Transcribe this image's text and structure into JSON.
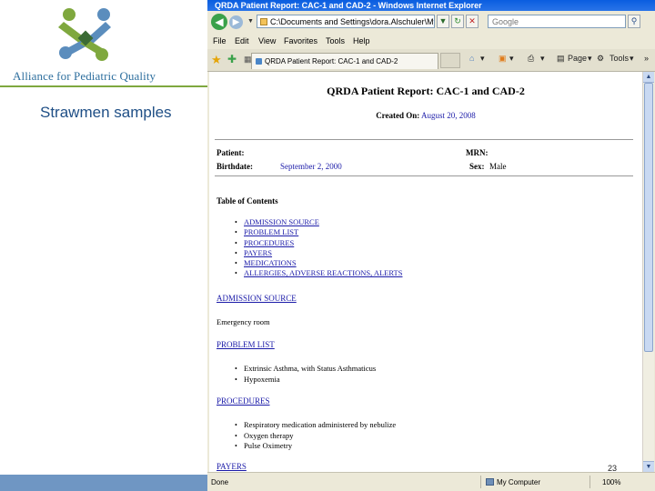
{
  "slide": {
    "org_name": "Alliance for Pediatric Quality",
    "subtitle": "Strawmen samples",
    "page_number": "23"
  },
  "browser": {
    "title": "QRDA Patient Report: CAC-1 and CAD-2 - Windows Internet Explorer",
    "address": "C:\\Documents and Settings\\dora.Alschuler\\My D",
    "search_placeholder": "Google",
    "menu": [
      "File",
      "Edit",
      "View",
      "Favorites",
      "Tools",
      "Help"
    ],
    "tab_title": "QRDA Patient Report: CAC-1 and CAD-2",
    "toolbar": {
      "page_label": "Page",
      "tools_label": "Tools"
    },
    "status": {
      "done": "Done",
      "zone": "My Computer",
      "zoom": "100%"
    }
  },
  "report": {
    "title": "QRDA Patient Report: CAC-1 and CAD-2",
    "created_label": "Created On:",
    "created_value": "August 20, 2008",
    "patient_label": "Patient:",
    "mrn_label": "MRN:",
    "birthdate_label": "Birthdate:",
    "birthdate_value": "September 2, 2000",
    "sex_label": "Sex:",
    "sex_value": "Male",
    "toc_heading": "Table of Contents",
    "toc": [
      "ADMISSION SOURCE",
      "PROBLEM LIST",
      "PROCEDURES",
      "PAYERS",
      "MEDICATIONS",
      "ALLERGIES, ADVERSE REACTIONS, ALERTS"
    ],
    "admission": {
      "heading": "ADMISSION SOURCE",
      "text": "Emergency room"
    },
    "problems": {
      "heading": "PROBLEM LIST",
      "items": [
        "Extrinsic Asthma, with Status Asthmaticus",
        "Hypoxemia"
      ]
    },
    "procedures": {
      "heading": "PROCEDURES",
      "items": [
        "Respiratory medication administered by nebulize",
        "Oxygen therapy",
        "Pulse Oximetry"
      ]
    },
    "payers": {
      "heading": "PAYERS"
    }
  },
  "colors": {
    "link": "#1a1aa8",
    "logo_green": "#7fa83e",
    "logo_blue": "#5b8dbd",
    "brand_text": "#2e6f9e"
  }
}
